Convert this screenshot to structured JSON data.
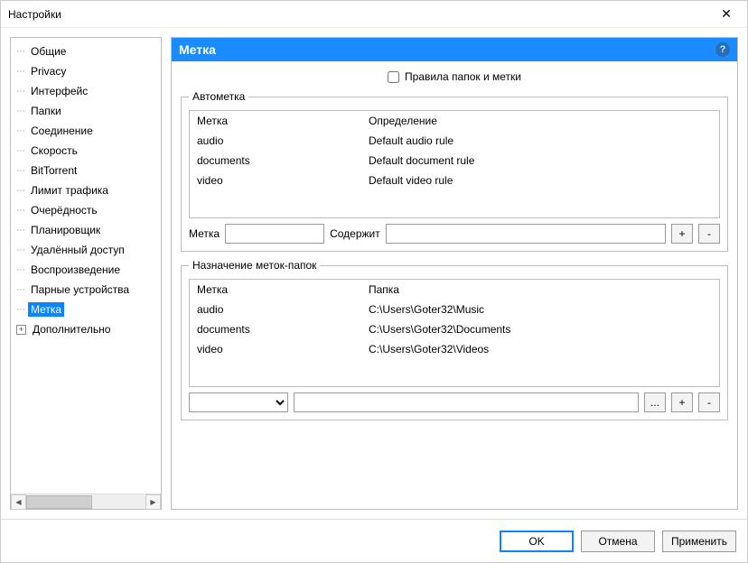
{
  "window": {
    "title": "Настройки",
    "close_glyph": "✕"
  },
  "sidebar": {
    "items": [
      {
        "label": "Общие"
      },
      {
        "label": "Privacy"
      },
      {
        "label": "Интерфейс"
      },
      {
        "label": "Папки"
      },
      {
        "label": "Соединение"
      },
      {
        "label": "Скорость"
      },
      {
        "label": "BitTorrent"
      },
      {
        "label": "Лимит трафика"
      },
      {
        "label": "Очерёдность"
      },
      {
        "label": "Планировщик"
      },
      {
        "label": "Удалённый доступ"
      },
      {
        "label": "Воспроизведение"
      },
      {
        "label": "Парные устройства"
      },
      {
        "label": "Метка"
      },
      {
        "label": "Дополнительно"
      }
    ]
  },
  "panel": {
    "title": "Метка",
    "help": "?",
    "rules_checkbox": "Правила папок и метки",
    "automark": {
      "legend": "Автометка",
      "col_metka": "Метка",
      "col_def": "Определение",
      "rows": [
        {
          "label": "audio",
          "def": "Default audio rule"
        },
        {
          "label": "documents",
          "def": "Default document rule"
        },
        {
          "label": "video",
          "def": "Default video rule"
        }
      ],
      "label_metka": "Метка",
      "label_contains": "Содержит",
      "plus": "+",
      "minus": "-"
    },
    "folders": {
      "legend": "Назначение меток-папок",
      "col_metka": "Метка",
      "col_path": "Папка",
      "rows": [
        {
          "label": "audio",
          "path": "C:\\Users\\Goter32\\Music"
        },
        {
          "label": "documents",
          "path": "C:\\Users\\Goter32\\Documents"
        },
        {
          "label": "video",
          "path": "C:\\Users\\Goter32\\Videos"
        }
      ],
      "browse": "...",
      "plus": "+",
      "minus": "-"
    }
  },
  "footer": {
    "ok": "OK",
    "cancel": "Отмена",
    "apply": "Применить"
  }
}
